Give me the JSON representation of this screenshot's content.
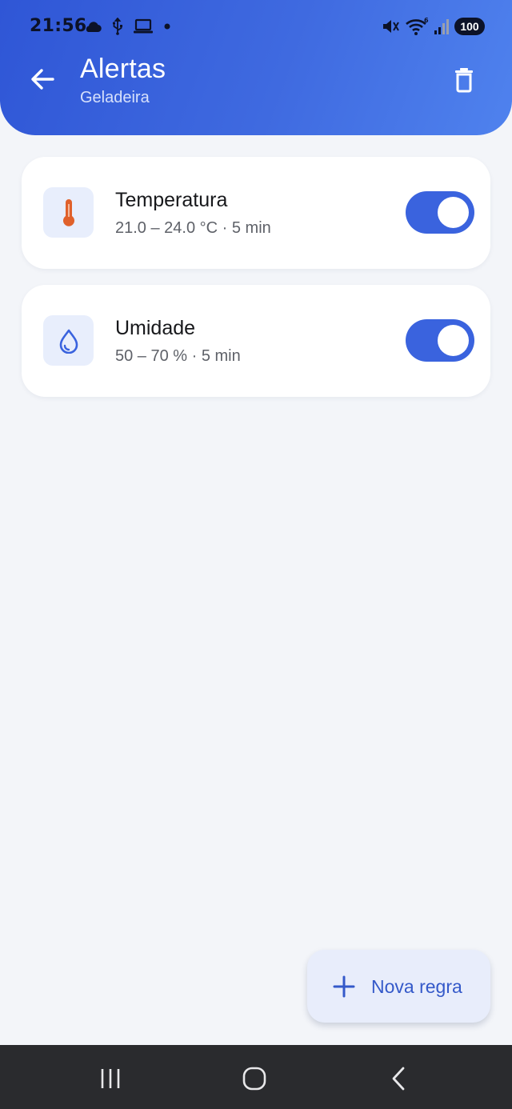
{
  "status_bar": {
    "time": "21:56",
    "left_icons": [
      "cloud-icon",
      "usb-icon",
      "laptop-icon",
      "dot-icon"
    ],
    "right_icons": [
      "mute-icon",
      "wifi-icon",
      "signal-icon"
    ],
    "battery": "100"
  },
  "header": {
    "title": "Alertas",
    "subtitle": "Geladeira",
    "back_icon": "arrow-left-icon",
    "delete_icon": "trash-icon"
  },
  "rules": [
    {
      "icon": "thermometer-icon",
      "title": "Temperatura",
      "description": "21.0 – 24.0 °C · 5 min",
      "enabled": true
    },
    {
      "icon": "water-drop-icon",
      "title": "Umidade",
      "description": "50 – 70 % · 5 min",
      "enabled": true
    }
  ],
  "fab": {
    "label": "Nova regra",
    "icon": "plus-icon"
  },
  "navigation_bar": [
    "recent-apps-icon",
    "home-icon",
    "back-icon"
  ],
  "colors": {
    "header_gradient_start": "#2f56d6",
    "header_gradient_end": "#4f82ee",
    "toggle_on": "#3a63de",
    "accent": "#3459c9",
    "thermometer": "#e0612b",
    "background": "#f3f5f9"
  }
}
